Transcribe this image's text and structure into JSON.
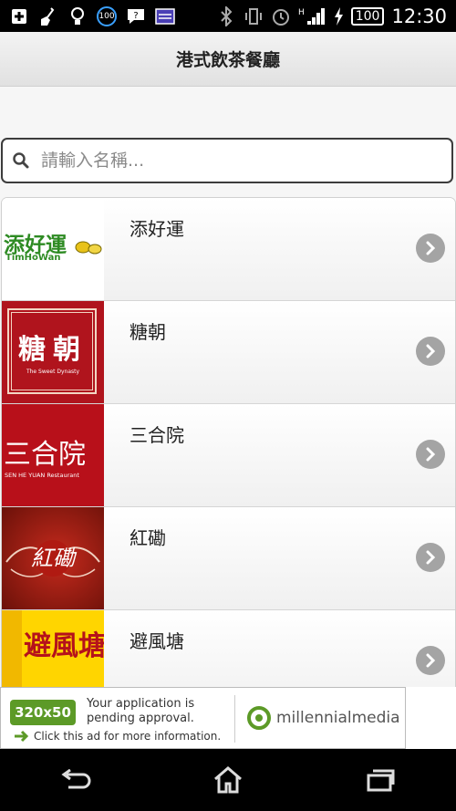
{
  "status": {
    "time": "12:30",
    "battery": "100",
    "badge_circle": "100",
    "network": "H",
    "icons": [
      "add-icon",
      "broom-icon",
      "bulb-icon",
      "badge-100-icon",
      "chat-icon",
      "calendar-icon",
      "bluetooth-icon",
      "vibrate-icon",
      "alarm-icon",
      "signal-icon",
      "charging-icon",
      "battery-icon"
    ]
  },
  "appbar": {
    "title": "港式飲茶餐廳"
  },
  "search": {
    "placeholder": "請輸入名稱..."
  },
  "restaurants": [
    {
      "name": "添好運",
      "logo_text": "添好運",
      "logo_sub": "TimHoWan",
      "colors": {
        "bg": "#ffffff",
        "fg": "#2e8b23"
      }
    },
    {
      "name": "糖朝",
      "logo_text": "糖朝",
      "logo_sub": "The Sweet Dynasty",
      "colors": {
        "bg": "#b0141d",
        "fg": "#ffffff"
      }
    },
    {
      "name": "三合院",
      "logo_text": "三合院",
      "logo_sub": "SEN HE YUAN Restaurant",
      "colors": {
        "bg": "#b8101a",
        "fg": "#ffffff"
      }
    },
    {
      "name": "紅磡",
      "logo_text": "紅磡",
      "logo_sub": "",
      "colors": {
        "bg": "#8e1a12",
        "fg": "#ffffff"
      }
    },
    {
      "name": "避風塘",
      "logo_text": "避風塘",
      "logo_sub": "",
      "colors": {
        "bg": "#ffd500",
        "fg": "#b5121b"
      }
    }
  ],
  "ad": {
    "size_label": "320x50",
    "message": "Your application is pending approval.",
    "click_text": "Click this ad for more information.",
    "brand": "millennialmedia"
  },
  "nav": {
    "back": "back-icon",
    "home": "home-icon",
    "recents": "recents-icon"
  }
}
